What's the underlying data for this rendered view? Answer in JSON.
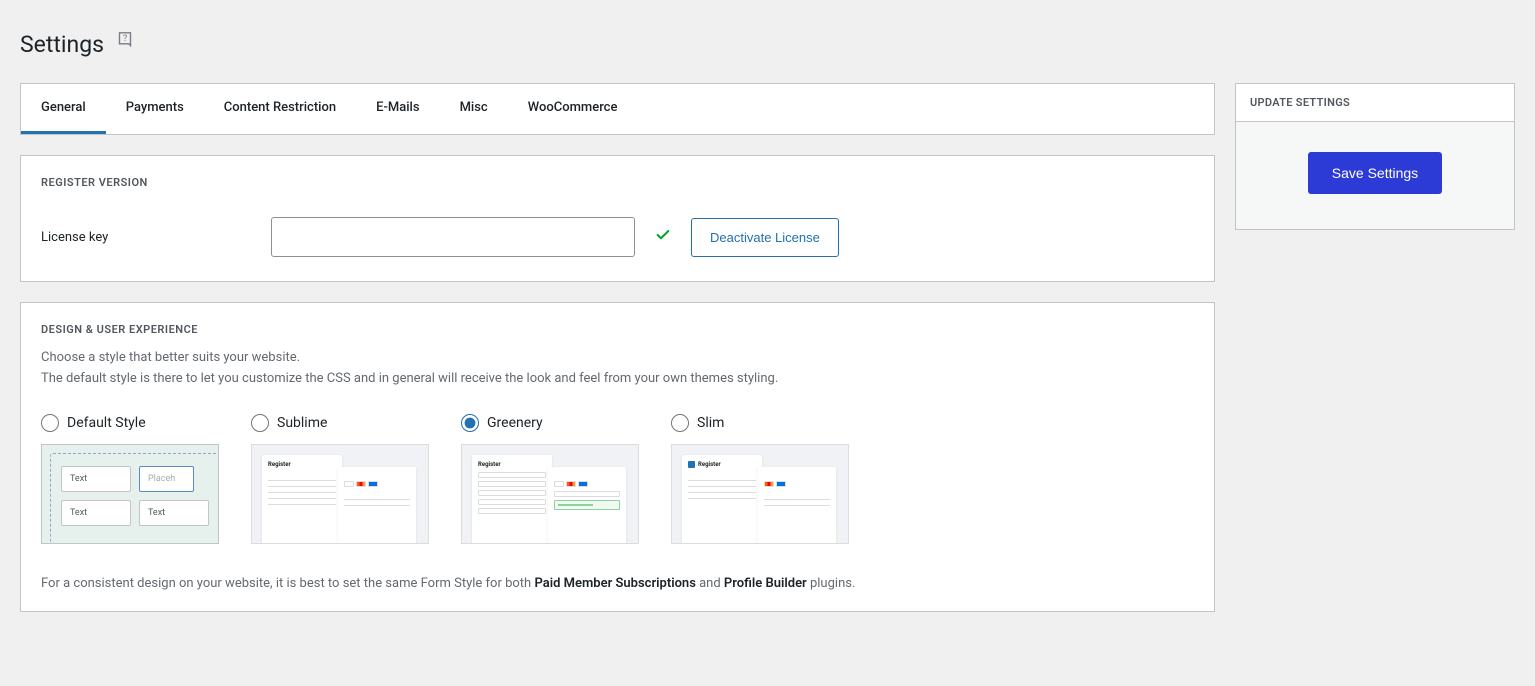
{
  "page": {
    "title": "Settings"
  },
  "tabs": [
    {
      "label": "General",
      "active": true
    },
    {
      "label": "Payments",
      "active": false
    },
    {
      "label": "Content Restriction",
      "active": false
    },
    {
      "label": "E-Mails",
      "active": false
    },
    {
      "label": "Misc",
      "active": false
    },
    {
      "label": "WooCommerce",
      "active": false
    }
  ],
  "register": {
    "heading": "REGISTER VERSION",
    "license_label": "License key",
    "license_value": "",
    "deactivate_button": "Deactivate License"
  },
  "design": {
    "heading": "DESIGN & USER EXPERIENCE",
    "description_line1": "Choose a style that better suits your website.",
    "description_line2": "The default style is there to let you customize the CSS and in general will receive the look and feel from your own themes styling.",
    "options": [
      {
        "label": "Default Style",
        "selected": false
      },
      {
        "label": "Sublime",
        "selected": false
      },
      {
        "label": "Greenery",
        "selected": true
      },
      {
        "label": "Slim",
        "selected": false
      }
    ],
    "preview_labels": {
      "text": "Text",
      "placeholder": "Placeh",
      "register": "Register"
    },
    "footnote_prefix": "For a consistent design on your website, it is best to set the same Form Style for both ",
    "footnote_plugin1": "Paid Member Subscriptions",
    "footnote_and": " and ",
    "footnote_plugin2": "Profile Builder",
    "footnote_suffix": " plugins."
  },
  "sidebar": {
    "heading": "UPDATE SETTINGS",
    "save_button": "Save Settings"
  }
}
